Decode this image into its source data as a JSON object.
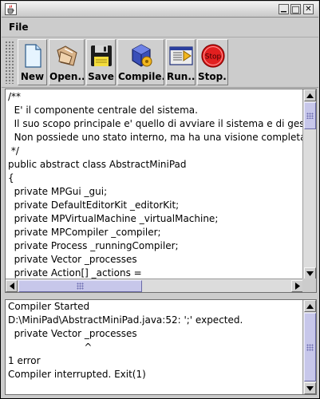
{
  "window": {
    "title": "",
    "controls": {
      "minimize": "▁",
      "maximize": "□",
      "close": "✕"
    }
  },
  "menubar": {
    "items": [
      {
        "label": "File"
      }
    ]
  },
  "toolbar": {
    "buttons": [
      {
        "label": "New",
        "icon": "new-document-icon"
      },
      {
        "label": "Open...",
        "icon": "open-folder-icon"
      },
      {
        "label": "Save",
        "icon": "floppy-disk-icon"
      },
      {
        "label": "Compile...",
        "icon": "compile-cube-icon"
      },
      {
        "label": "Run...",
        "icon": "run-window-icon"
      },
      {
        "label": "Stop...",
        "icon": "stop-sign-icon"
      }
    ],
    "stop_sign_text": "Stop"
  },
  "editor": {
    "lines": [
      "/**",
      "  E' il componente centrale del sistema.",
      "  Il suo scopo principale e' quello di avviare il sistema e di gestire lo",
      "  Non possiede uno stato interno, ma ha una visione completa dello",
      " */",
      "public abstract class AbstractMiniPad",
      "{",
      "  private MPGui _gui;",
      "  private DefaultEditorKit _editorKit;",
      "  private MPVirtualMachine _virtualMachine;",
      "  private MPCompiler _compiler;",
      "  private Process _runningCompiler;",
      "  private Vector _processes",
      "  private Action[] _actions ="
    ]
  },
  "console": {
    "lines": [
      "Compiler Started",
      "D:\\MiniPad\\AbstractMiniPad.java:52: ';' expected.",
      "  private Vector _processes",
      "                         ^",
      "1 error",
      "Compiler interrupted. Exit(1)"
    ]
  },
  "colors": {
    "scroll_thumb": "#c7c7ea",
    "background": "#cccccc"
  }
}
